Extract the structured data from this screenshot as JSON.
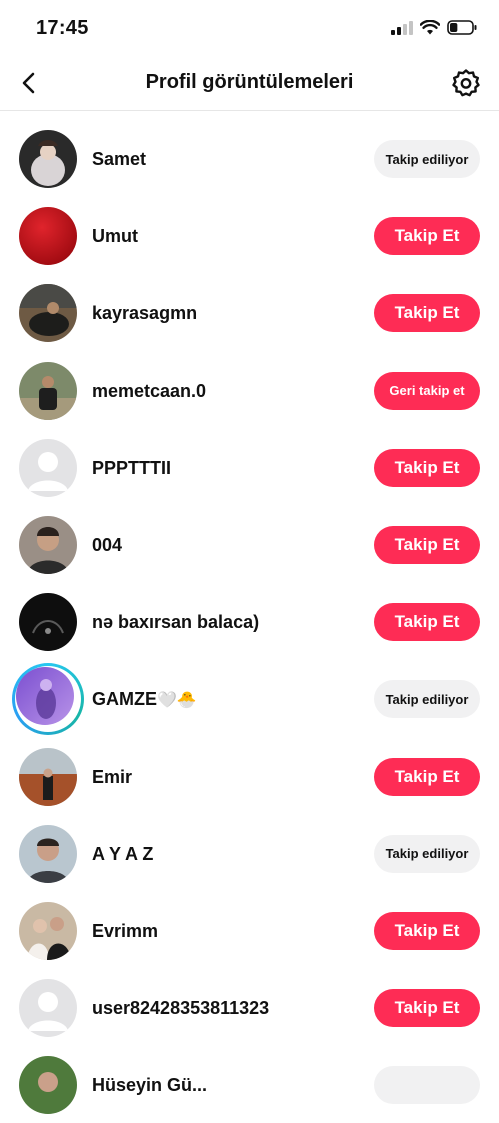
{
  "status_bar": {
    "time": "17:45",
    "battery_level": 0.35
  },
  "nav": {
    "title": "Profil görüntülemeleri"
  },
  "colors": {
    "accent": "#fe2c55",
    "secondary_button_bg": "#f1f1f2",
    "story_ring": "#27c8f0"
  },
  "rows": [
    {
      "username": "Samet",
      "button_label": "Takip ediliyor",
      "button_type": "following",
      "avatar": "photo-light"
    },
    {
      "username": "Umut",
      "button_label": "Takip Et",
      "button_type": "follow",
      "avatar": "red"
    },
    {
      "username": "kayrasagmn",
      "button_label": "Takip Et",
      "button_type": "follow",
      "avatar": "photo-dark"
    },
    {
      "username": "memetcaan.0",
      "button_label": "Geri takip et",
      "button_type": "followback",
      "avatar": "photo-outdoor"
    },
    {
      "username": "PPPTTTII",
      "button_label": "Takip Et",
      "button_type": "follow",
      "avatar": "placeholder"
    },
    {
      "username": "004",
      "button_label": "Takip Et",
      "button_type": "follow",
      "avatar": "photo-portrait"
    },
    {
      "username": "nə baxırsan balaca)",
      "button_label": "Takip Et",
      "button_type": "follow",
      "avatar": "photo-black"
    },
    {
      "username": "GAMZE",
      "username_emoji": "🤍🐣",
      "button_label": "Takip ediliyor",
      "button_type": "following",
      "avatar": "photo-purple",
      "story_ring": true
    },
    {
      "username": "Emir",
      "button_label": "Takip Et",
      "button_type": "follow",
      "avatar": "photo-autumn"
    },
    {
      "username": "A Y A Z",
      "button_label": "Takip ediliyor",
      "button_type": "following",
      "avatar": "photo-portrait2"
    },
    {
      "username": "Evrimm",
      "button_label": "Takip Et",
      "button_type": "follow",
      "avatar": "photo-couple"
    },
    {
      "username": "user82428353811323",
      "button_label": "Takip Et",
      "button_type": "follow",
      "avatar": "placeholder"
    },
    {
      "username": "Hüseyin Gü...",
      "button_label": "",
      "button_type": "following",
      "avatar": "photo-green"
    }
  ]
}
